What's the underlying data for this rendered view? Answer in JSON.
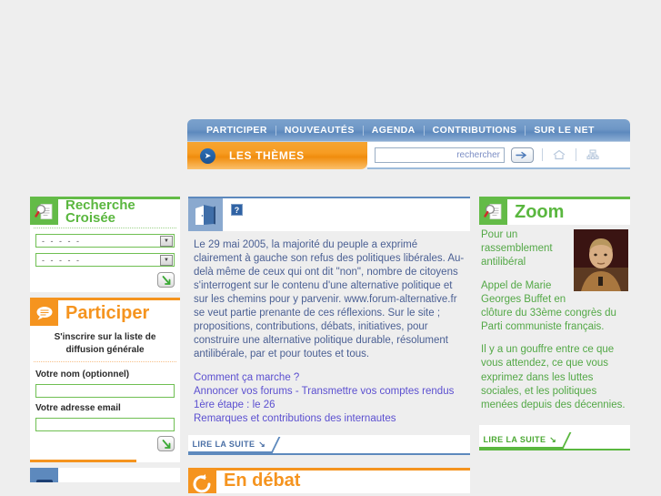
{
  "site": {
    "url_mention": "www.forum-alternative.fr"
  },
  "nav": {
    "items": [
      {
        "label": "PARTICIPER"
      },
      {
        "label": "NOUVEAUTÉS"
      },
      {
        "label": "AGENDA"
      },
      {
        "label": "CONTRIBUTIONS"
      },
      {
        "label": "SUR LE NET"
      }
    ],
    "themes_label": "LES THÈMES",
    "themes_arrow_icon": "chevron-right-icon"
  },
  "search": {
    "placeholder": "rechercher",
    "value": "",
    "go_icon": "arrow-right-icon",
    "home_icon": "home-icon",
    "sitemap_icon": "sitemap-icon"
  },
  "left_column": {
    "recherche_croisee": {
      "title_line1": "Recherche",
      "title_line2": "Croisée",
      "icon": "document-search-icon",
      "select1": {
        "value": "- - - - -"
      },
      "select2": {
        "value": "- - - - -"
      },
      "submit_icon": "green-arrow-submit-icon",
      "arrow_glyph": "▼"
    },
    "participer": {
      "title": "Participer",
      "icon": "speech-bubble-icon",
      "subtitle": "S'inscrire sur la liste de diffusion générale",
      "name_label": "Votre nom (optionnel)",
      "name_value": "",
      "email_label": "Votre adresse email",
      "email_value": "",
      "submit_icon": "green-arrow-submit-icon"
    },
    "agenda_partial": {
      "icon": "calendar-icon"
    }
  },
  "center_column": {
    "door_icon": "open-door-icon",
    "help_icon": "question-mark-icon",
    "help_label": "?",
    "intro_paragraph": "Le 29 mai 2005, la majorité du peuple a exprimé clairement à gauche son refus des politiques libérales. Au-delà même de ceux qui ont dit \"non\", nombre de citoyens s'interrogent sur le contenu d'une alternative politique et sur les chemins pour y parvenir. www.forum-alternative.fr se veut partie prenante de ces réflexions. Sur le site ; propositions, contributions, débats, initiatives, pour construire une alternative politique durable, résolument antilibérale, par et pour toutes et tous.",
    "links": [
      "Comment ça marche ?",
      "Annoncer vos forums - Transmettre vos comptes rendus",
      "1ère étape : le 26",
      "Remarques et contributions des internautes"
    ],
    "lire_la_suite": "LIRE LA SUITE",
    "lire_arrow_icon": "arrow-down-right-icon",
    "en_debat": {
      "title": "En débat",
      "icon": "refresh-arrow-icon"
    }
  },
  "right_column": {
    "zoom": {
      "title": "Zoom",
      "icon": "document-search-icon",
      "headline": "Pour un rassemblement antilibéral",
      "photo_alt": "portrait-photo",
      "paragraph1": "Appel de Marie Georges Buffet en clôture du 33ème congrès du Parti communiste français.",
      "paragraph2": "Il y a un gouffre entre ce que vous attendez, ce que vous exprimez dans les luttes sociales, et les politiques menées depuis des décennies.",
      "lire_la_suite": "LIRE LA SUITE",
      "lire_arrow_icon": "arrow-down-right-icon"
    }
  },
  "colors": {
    "page_bg": "#eeeeee",
    "nav_blue": "#6e97c6",
    "accent_orange": "#f5941f",
    "accent_green": "#5ab73f",
    "body_text_blue": "#4a5f93",
    "link_purple": "#5b4fd0",
    "zoom_text_green": "#53a846"
  }
}
